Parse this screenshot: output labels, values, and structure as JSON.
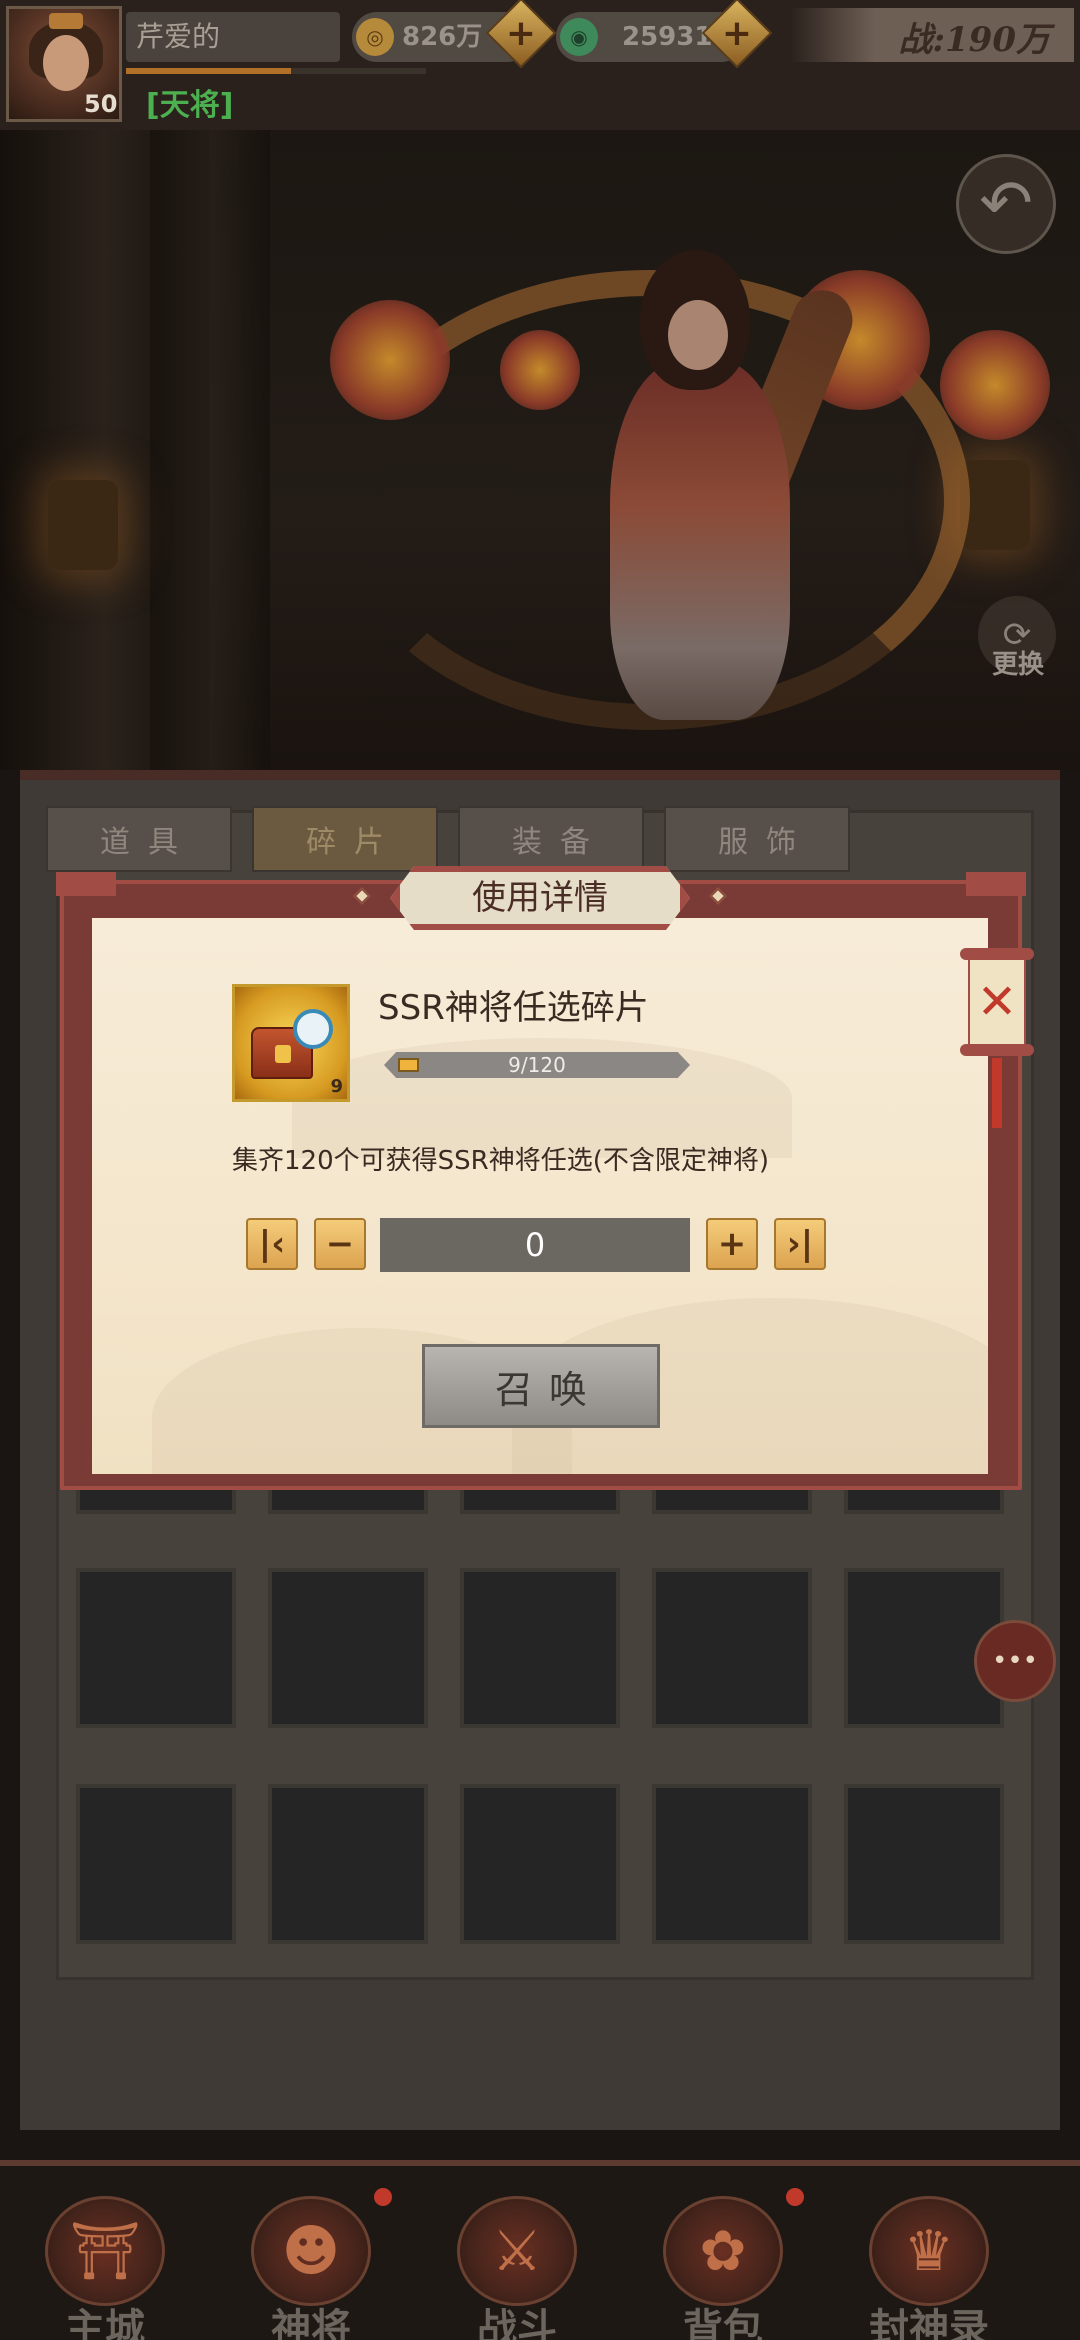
{
  "topbar": {
    "player_name": "芹爱的",
    "level": "50",
    "rank_title": "[天将]",
    "xp_fraction": 0.55,
    "coins": "826万",
    "jade": "25931",
    "battle_power": "战:190万"
  },
  "scene": {
    "swap_label": "更换"
  },
  "tabs": [
    {
      "label": "道具",
      "active": false
    },
    {
      "label": "碎片",
      "active": true
    },
    {
      "label": "装备",
      "active": false
    },
    {
      "label": "服饰",
      "active": false
    }
  ],
  "dialog": {
    "title": "使用详情",
    "item_name": "SSR神将任选碎片",
    "item_count_badge": "9",
    "progress_text": "9/120",
    "progress_fraction": 0.075,
    "description": "集齐120个可获得SSR神将任选(不含限定神将)",
    "quantity": "0",
    "min_btn": "K",
    "minus_btn": "−",
    "plus_btn": "+",
    "max_btn": "K",
    "summon_label": "召唤",
    "close_label": "✕"
  },
  "nav": [
    {
      "label": "主城",
      "icon": "city-gate-icon",
      "glyph": "⛩"
    },
    {
      "label": "神将",
      "icon": "hero-portrait-icon",
      "glyph": "☻"
    },
    {
      "label": "战斗",
      "icon": "crossed-swords-icon",
      "glyph": "⚔"
    },
    {
      "label": "背包",
      "icon": "bag-icon",
      "glyph": "✿"
    },
    {
      "label": "封神录",
      "icon": "scroll-book-icon",
      "glyph": "♛"
    }
  ],
  "colors": {
    "accent_red": "#a14d45",
    "gold": "#f0b43c",
    "rank_green": "#4caf50"
  }
}
